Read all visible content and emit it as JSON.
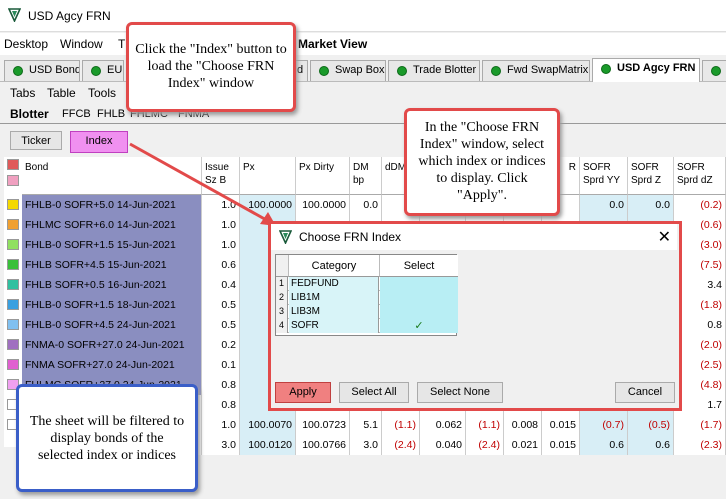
{
  "window": {
    "title": "USD Agcy FRN"
  },
  "menu": [
    "Desktop",
    "Window",
    "T",
    "Market View"
  ],
  "top_tabs": [
    {
      "label": "USD Bond"
    },
    {
      "label": "EUR"
    },
    {
      "label": "d"
    },
    {
      "label": "Swap Box"
    },
    {
      "label": "Trade Blotter"
    },
    {
      "label": "Fwd SwapMatrix"
    },
    {
      "label": "USD Agcy FRN"
    },
    {
      "label": "G"
    }
  ],
  "sub_menu": [
    "Tabs",
    "Table",
    "Tools"
  ],
  "sheet_tabs": [
    "Blotter",
    "FFCB",
    "FHLB",
    "FHLMC",
    "FNMA"
  ],
  "buttons": {
    "ticker": "Ticker",
    "index": "Index"
  },
  "grid": {
    "headers": {
      "bond": "Bond",
      "issue": "Issue Sz B",
      "px": "Px",
      "px_dirty": "Px Dirty",
      "dm": "DM bp",
      "ddm": "dDM",
      "r": "R",
      "sofr_yy": "SOFR Sprd YY",
      "sofr_z": "SOFR Sprd Z",
      "sofr_dz": "SOFR Sprd dZ"
    },
    "row_colors": [
      "#e05a5a",
      "#f0a0c0",
      "#f5d800",
      "#f0a030",
      "#90e060",
      "#3ac03a",
      "#30c0a0",
      "#3aa0e0",
      "#80c0f0",
      "#a070c0",
      "#e060d0",
      "#f0a0f0",
      "#ffffff",
      "#ffffff"
    ],
    "rows": [
      {
        "bond": "FHLB-0 SOFR+5.0 14-Jun-2021",
        "issue": "1.0",
        "px": "100.0000",
        "px_dirty": "100.0000",
        "dm": "0.0",
        "ddm": "(5.",
        "r": "000",
        "yy": "0.0",
        "z": "0.0",
        "dz": "(0.2)"
      },
      {
        "bond": "FHLMC SOFR+6.0 14-Jun-2021",
        "issue": "1.0",
        "px": "",
        "px_dirty": "",
        "dm": "",
        "ddm": "",
        "r": "",
        "yy": "",
        "z": "",
        "dz": "(0.6)"
      },
      {
        "bond": "FHLB-0 SOFR+1.5 15-Jun-2021",
        "issue": "1.0",
        "px": "",
        "px_dirty": "",
        "dm": "",
        "ddm": "",
        "r": "",
        "yy": "",
        "z": "",
        "dz": "(3.0)"
      },
      {
        "bond": "FHLB SOFR+4.5 15-Jun-2021",
        "issue": "0.6",
        "px": "",
        "px_dirty": "",
        "dm": "",
        "ddm": "",
        "r": "",
        "yy": "",
        "z": "",
        "dz": "(7.5)"
      },
      {
        "bond": "FHLB SOFR+0.5 16-Jun-2021",
        "issue": "0.4",
        "px": "",
        "px_dirty": "",
        "dm": "",
        "ddm": "",
        "r": "",
        "yy": "",
        "z": "",
        "dz": "3.4"
      },
      {
        "bond": "FHLB-0 SOFR+1.5 18-Jun-2021",
        "issue": "0.5",
        "px": "",
        "px_dirty": "",
        "dm": "",
        "ddm": "",
        "r": "",
        "yy": "",
        "z": "",
        "dz": "(1.8)"
      },
      {
        "bond": "FHLB-0 SOFR+4.5 24-Jun-2021",
        "issue": "0.5",
        "px": "",
        "px_dirty": "",
        "dm": "",
        "ddm": "",
        "r": "",
        "yy": "",
        "z": "",
        "dz": "0.8"
      },
      {
        "bond": "FNMA-0 SOFR+27.0 24-Jun-2021",
        "issue": "0.2",
        "px": "",
        "px_dirty": "",
        "dm": "",
        "ddm": "",
        "r": "",
        "yy": "",
        "z": "",
        "dz": "(2.0)"
      },
      {
        "bond": "FNMA SOFR+27.0 24-Jun-2021",
        "issue": "0.1",
        "px": "",
        "px_dirty": "",
        "dm": "",
        "ddm": "",
        "r": "",
        "yy": "",
        "z": "",
        "dz": "(2.5)"
      },
      {
        "bond": "FHLMC SOFR+27.0 24-Jun-2021",
        "issue": "0.8",
        "px": "",
        "px_dirty": "",
        "dm": "",
        "ddm": "",
        "r": "",
        "yy": "",
        "z": "",
        "dz": "(4.8)"
      },
      {
        "bond": "",
        "issue": "0.8",
        "px": "",
        "px_dirty": "",
        "dm": "",
        "ddm": "",
        "r": "",
        "yy": "",
        "z": "",
        "dz": "1.7"
      },
      {
        "bond": "",
        "issue": "1.0",
        "px": "100.0070",
        "px_dirty": "100.0723",
        "dm": "5.1",
        "ddm": "(1.1)",
        "r": "0.062",
        "r2": "(1.1)",
        "r3": "0.008",
        "r4": "0.015",
        "yy": "(0.7)",
        "z": "(0.5)",
        "dz": "(1.7)"
      },
      {
        "bond": "",
        "issue": "3.0",
        "px": "100.0120",
        "px_dirty": "100.0766",
        "dm": "3.0",
        "ddm": "(2.4)",
        "r": "0.040",
        "r2": "(2.4)",
        "r3": "0.021",
        "r4": "0.015",
        "yy": "0.6",
        "z": "0.6",
        "dz": "(2.3)"
      }
    ]
  },
  "dialog": {
    "title": "Choose FRN Index",
    "col_category": "Category",
    "col_select": "Select",
    "rows": [
      {
        "n": "1",
        "category": "FEDFUND",
        "select": ""
      },
      {
        "n": "2",
        "category": "LIB1M",
        "select": ""
      },
      {
        "n": "3",
        "category": "LIB3M",
        "select": ""
      },
      {
        "n": "4",
        "category": "SOFR",
        "select": "✓"
      }
    ],
    "buttons": {
      "apply": "Apply",
      "select_all": "Select All",
      "select_none": "Select None",
      "cancel": "Cancel"
    }
  },
  "callouts": {
    "index_button": "Click the \"Index\" button to load the \"Choose FRN Index\" window",
    "choose_window": "In the \"Choose FRN Index\" window, select which index or indices to display. Click \"Apply\".",
    "filter_note": "The sheet will be filtered to display bonds of the selected index or indices"
  }
}
